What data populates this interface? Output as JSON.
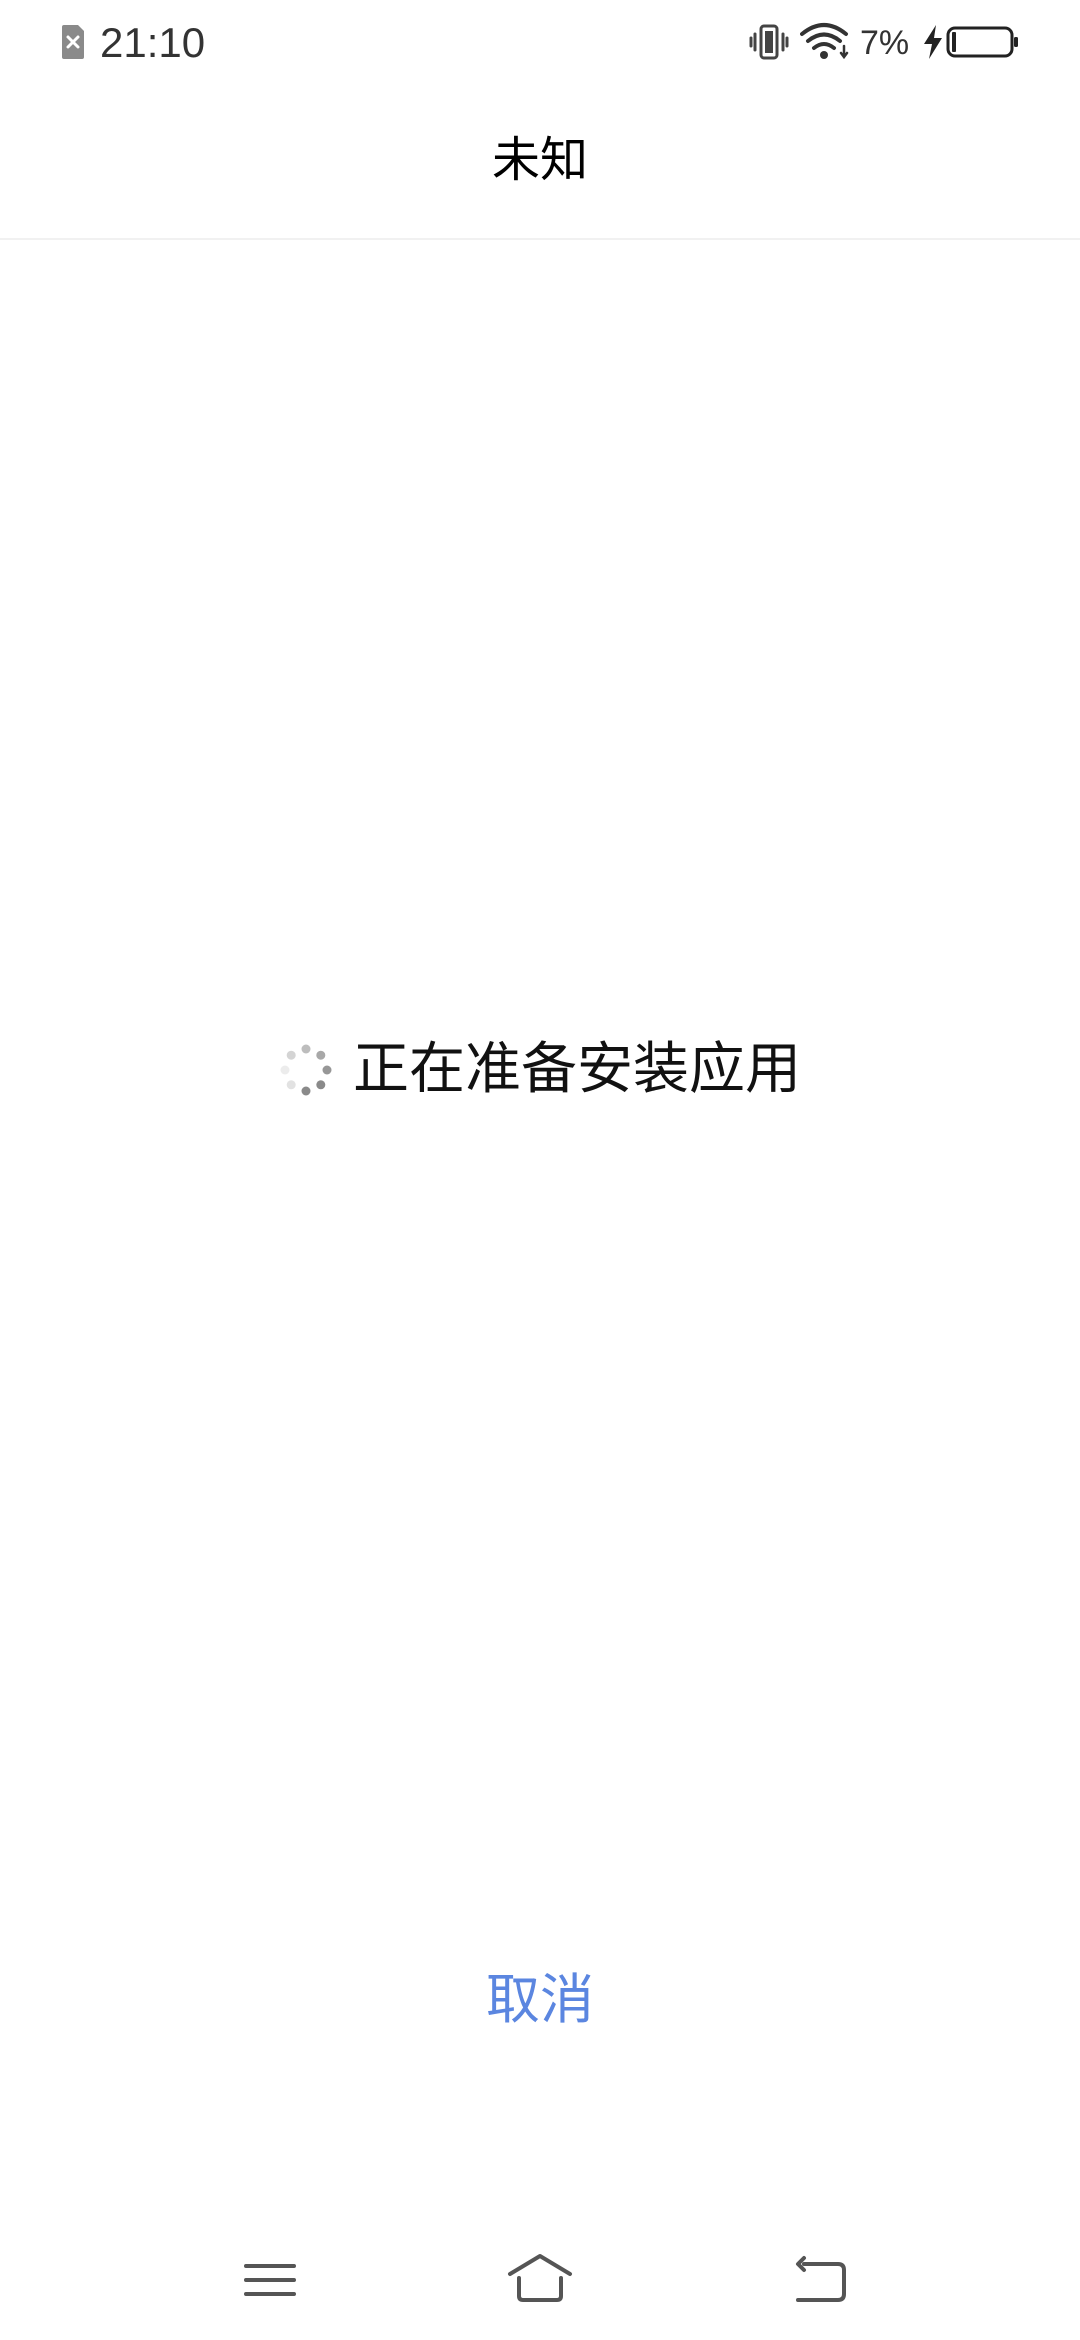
{
  "status_bar": {
    "time": "21:10",
    "battery_percent": "7%",
    "icons": [
      "sim-missing-icon",
      "vibrate-icon",
      "wifi-icon",
      "charging-icon",
      "battery-icon"
    ]
  },
  "header": {
    "title": "未知"
  },
  "main": {
    "loading_text": "正在准备安装应用",
    "spinner_icon": "loading-spinner-icon"
  },
  "footer": {
    "cancel_label": "取消"
  },
  "nav_bar": {
    "icons": [
      "menu-icon",
      "home-icon",
      "back-icon"
    ]
  },
  "colors": {
    "accent": "#5b86e0",
    "background": "#ffffff",
    "text": "#111111"
  }
}
